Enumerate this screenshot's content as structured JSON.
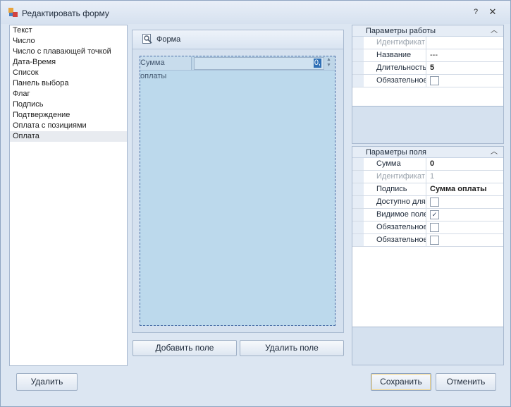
{
  "window": {
    "title": "Редактировать форму",
    "icons": {
      "app": "app-form-icon",
      "help": "help-icon",
      "close": "close-icon"
    }
  },
  "field_types": [
    "Текст",
    "Число",
    "Число с плавающей точкой",
    "Дата-Время",
    "Список",
    "Панель выбора",
    "Флаг",
    "Подпись",
    "Подтверждение",
    "Оплата с позициями",
    "Оплата"
  ],
  "selected_field_type": "Оплата",
  "form": {
    "title": "Форма",
    "icon": "form-designer-icon",
    "field": {
      "label": "Сумма оплаты",
      "value": "0,"
    },
    "add_button": "Добавить поле",
    "delete_button": "Удалить поле"
  },
  "work_params": {
    "title": "Параметры работы",
    "rows": [
      {
        "name": "Идентификат",
        "value": "",
        "type": "text",
        "disabled": true
      },
      {
        "name": "Название",
        "value": "---",
        "type": "text",
        "disabled": false
      },
      {
        "name": "Длительность",
        "value": "5",
        "type": "bold",
        "disabled": false
      },
      {
        "name": "Обязательное",
        "value": "",
        "type": "checkbox",
        "checked": false,
        "disabled": false
      }
    ]
  },
  "field_params": {
    "title": "Параметры поля",
    "rows": [
      {
        "name": "Сумма",
        "value": "0",
        "type": "bold",
        "disabled": false
      },
      {
        "name": "Идентификат",
        "value": "1",
        "type": "text",
        "disabled": true
      },
      {
        "name": "Подпись",
        "value": "Сумма оплаты",
        "type": "bold",
        "disabled": false
      },
      {
        "name": "Доступно для",
        "value": "",
        "type": "checkbox",
        "checked": false,
        "disabled": false
      },
      {
        "name": "Видимое поле",
        "value": "",
        "type": "checkbox",
        "checked": true,
        "disabled": false
      },
      {
        "name": "Обязательное",
        "value": "",
        "type": "checkbox",
        "checked": false,
        "disabled": false
      },
      {
        "name": "Обязательное",
        "value": "",
        "type": "checkbox",
        "checked": false,
        "disabled": false
      }
    ]
  },
  "buttons": {
    "delete": "Удалить",
    "save": "Сохранить",
    "cancel": "Отменить"
  },
  "colors": {
    "window_bg": "#dce6f2",
    "canvas_bg": "#bcd9ec",
    "selection": "#2f6fb5"
  }
}
